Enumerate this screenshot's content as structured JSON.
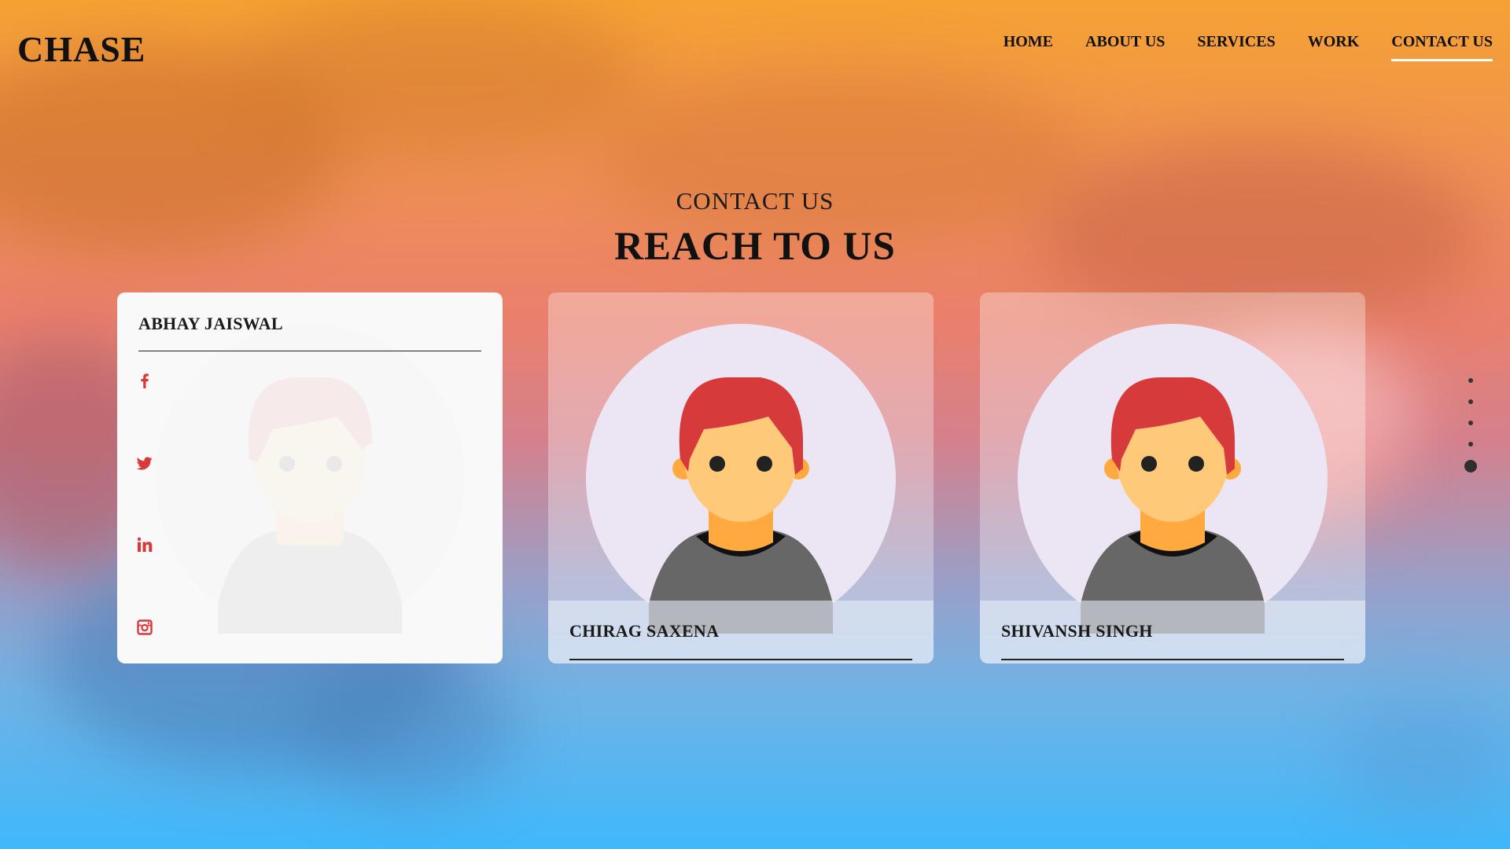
{
  "brand": {
    "name": "CHASE"
  },
  "nav": {
    "items": [
      {
        "label": "HOME"
      },
      {
        "label": "ABOUT US"
      },
      {
        "label": "SERVICES"
      },
      {
        "label": "WORK"
      },
      {
        "label": "CONTACT US",
        "active": true
      }
    ]
  },
  "section": {
    "eyebrow": "CONTACT US",
    "headline": "REACH TO US"
  },
  "cards": [
    {
      "name": "ABHAY JAISWAL",
      "state": "flipped",
      "social": [
        {
          "icon": "facebook-icon"
        },
        {
          "icon": "twitter-icon"
        },
        {
          "icon": "linkedin-icon"
        },
        {
          "icon": "instagram-icon"
        }
      ]
    },
    {
      "name": "CHIRAG SAXENA",
      "state": "front"
    },
    {
      "name": "SHIVANSH SINGH",
      "state": "front"
    }
  ],
  "page_indicator": {
    "count": 5,
    "active_index": 4
  },
  "colors": {
    "gradient_top": "#f5a233",
    "gradient_bottom": "#3fb8fb",
    "accent_red": "#d63a3a",
    "avatar_bg": "#ece6f4",
    "skin": "#ffc97a",
    "shirt": "#676767"
  }
}
